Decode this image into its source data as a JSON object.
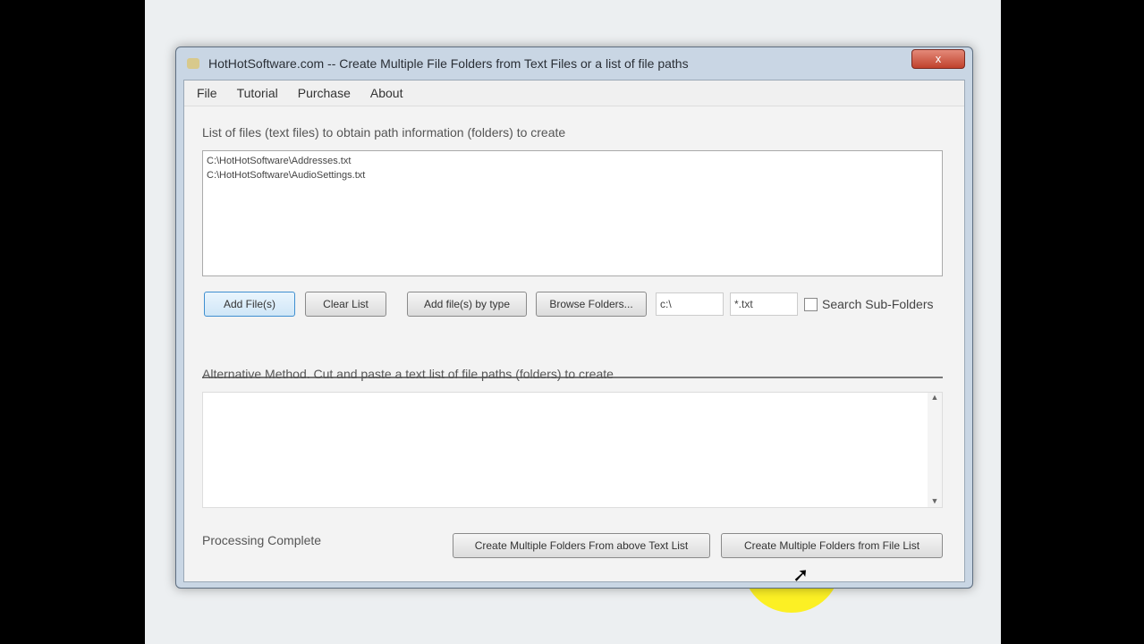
{
  "window": {
    "title": "HotHotSoftware.com -- Create Multiple File Folders from Text Files or a list of file paths",
    "close": "x"
  },
  "menu": [
    "File",
    "Tutorial",
    "Purchase",
    "About"
  ],
  "files_label": "List of files (text files) to obtain path information (folders) to create",
  "files": [
    "C:\\HotHotSoftware\\Addresses.txt",
    "C:\\HotHotSoftware\\AudioSettings.txt"
  ],
  "buttons": {
    "add_files": "Add File(s)",
    "clear_list": "Clear List",
    "add_by_type": "Add file(s) by type",
    "browse": "Browse Folders..."
  },
  "inputs": {
    "folder": "c:\\",
    "pattern": "*.txt"
  },
  "search_sub": "Search Sub-Folders",
  "alt_label": "Alternative Method. Cut and paste a text list of file paths (folders) to create",
  "status": "Processing Complete",
  "create_text": "Create Multiple Folders From above Text List",
  "create_file": "Create Multiple Folders from File List"
}
